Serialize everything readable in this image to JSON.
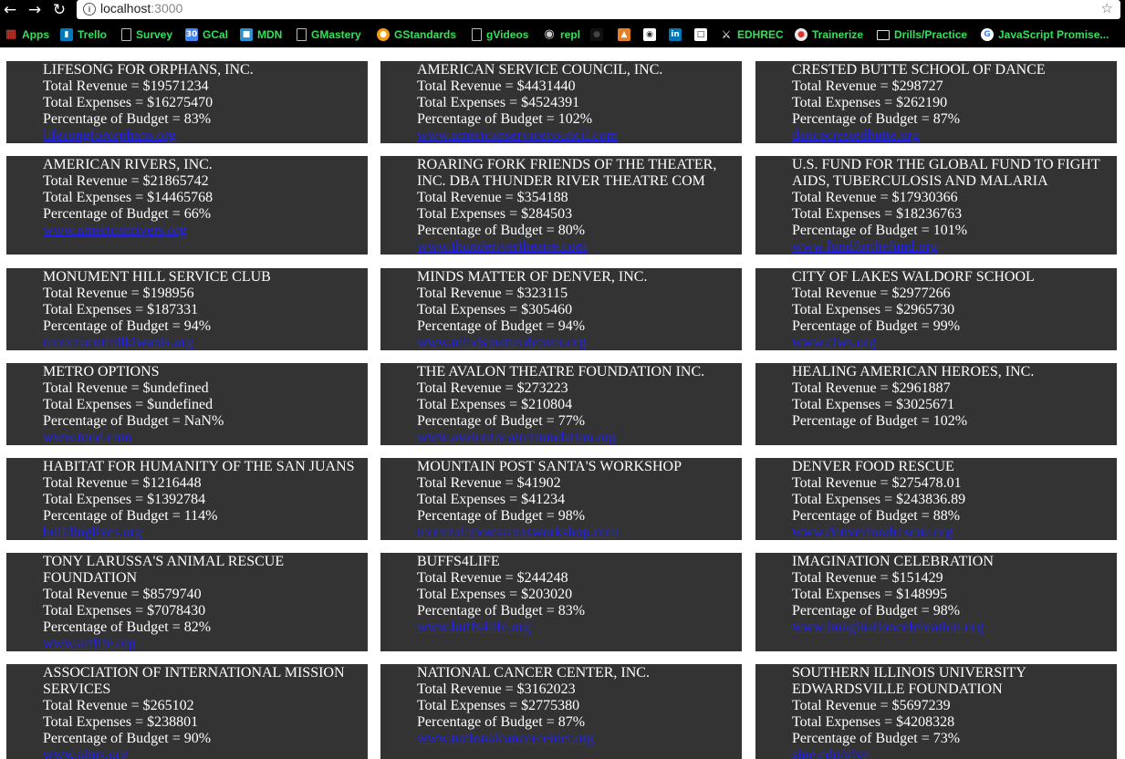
{
  "browser": {
    "url_host": "localhost",
    "url_port": ":3000",
    "bookmarks": [
      {
        "label": "Apps",
        "icon": "apps-grid-icon"
      },
      {
        "label": "Trello",
        "icon": "trello-icon"
      },
      {
        "label": "Survey",
        "icon": "page-icon"
      },
      {
        "label": "GCal",
        "icon": "calendar-icon",
        "badge": "30"
      },
      {
        "label": "MDN",
        "icon": "mdn-icon"
      },
      {
        "label": "GMastery",
        "icon": "page-icon"
      },
      {
        "label": "GStandards",
        "icon": "gstandards-icon"
      },
      {
        "label": "gVideos",
        "icon": "page-icon"
      },
      {
        "label": "repl",
        "icon": "repl-icon"
      },
      {
        "label": "",
        "icon": "github-icon"
      },
      {
        "label": "",
        "icon": "fitness-icon"
      },
      {
        "label": "",
        "icon": "owl-icon"
      },
      {
        "label": "",
        "icon": "linkedin-icon",
        "badge": "in"
      },
      {
        "label": "",
        "icon": "mtg-icon"
      },
      {
        "label": "EDHREC",
        "icon": "edhrec-icon"
      },
      {
        "label": "Trainerize",
        "icon": "trainerize-icon"
      },
      {
        "label": "Drills/Practice",
        "icon": "folder-icon"
      },
      {
        "label": "JavaScript Promise...",
        "icon": "google-icon"
      }
    ]
  },
  "labels": {
    "revenue": "Total Revenue = ",
    "expenses": "Total Expenses = ",
    "budget": "Percentage of Budget = "
  },
  "cards": [
    {
      "name": "LIFESONG FOR ORPHANS, INC.",
      "revenue": "$19571234",
      "expenses": "$16275470",
      "budget": "83%",
      "link": "lifesongfororphans.org"
    },
    {
      "name": "AMERICAN SERVICE COUNCIL, INC.",
      "revenue": "$4431440",
      "expenses": "$4524391",
      "budget": "102%",
      "link": "www.americanservicecouncil.com"
    },
    {
      "name": "CRESTED BUTTE SCHOOL OF DANCE",
      "revenue": "$298727",
      "expenses": "$262190",
      "budget": "87%",
      "link": "dancecrestedbutte.org"
    },
    {
      "name": "AMERICAN RIVERS, INC.",
      "revenue": "$21865742",
      "expenses": "$14465768",
      "budget": "66%",
      "link": "www.americanrivers.org"
    },
    {
      "name": "ROARING FORK FRIENDS OF THE THEATER, INC. DBA THUNDER RIVER THEATRE COM",
      "revenue": "$354188",
      "expenses": "$284503",
      "budget": "80%",
      "link": "www.thunderivertheatre.com"
    },
    {
      "name": "U.S. FUND FOR THE GLOBAL FUND TO FIGHT AIDS, TUBERCULOSIS AND MALARIA",
      "revenue": "$17930366",
      "expenses": "$18236763",
      "budget": "101%",
      "link": "www.fundforthefund.org"
    },
    {
      "name": "MONUMENT HILL SERVICE CLUB",
      "revenue": "$198956",
      "expenses": "$187331",
      "budget": "94%",
      "link": "monumenthillkiwanis.org"
    },
    {
      "name": "MINDS MATTER OF DENVER, INC.",
      "revenue": "$323115",
      "expenses": "$305460",
      "budget": "94%",
      "link": "www.mindsmatterdenver.org"
    },
    {
      "name": "CITY OF LAKES WALDORF SCHOOL",
      "revenue": "$2977266",
      "expenses": "$2965730",
      "budget": "99%",
      "link": "www.clws.org"
    },
    {
      "name": "METRO OPTIONS",
      "revenue": "$undefined",
      "expenses": "$undefined",
      "budget": "NaN%",
      "link": "www.mod.com"
    },
    {
      "name": "THE AVALON THEATRE FOUNDATION INC.",
      "revenue": "$273223",
      "expenses": "$210804",
      "budget": "77%",
      "link": "www.avalontheatrefoundation.org"
    },
    {
      "name": "HEALING AMERICAN HEROES, INC.",
      "revenue": "$2961887",
      "expenses": "$3025671",
      "budget": "102%",
      "link": ""
    },
    {
      "name": "HABITAT FOR HUMANITY OF THE SAN JUANS",
      "revenue": "$1216448",
      "expenses": "$1392784",
      "budget": "114%",
      "link": "buildinglives.org"
    },
    {
      "name": "MOUNTAIN POST SANTA'S WORKSHOP",
      "revenue": "$41902",
      "expenses": "$41234",
      "budget": "98%",
      "link": "mountainpostsantasworkshop.com"
    },
    {
      "name": "DENVER FOOD RESCUE",
      "revenue": "$275478.01",
      "expenses": "$243836.89",
      "budget": "88%",
      "link": "www.denverfoodrescue.org"
    },
    {
      "name": "TONY LARUSSA'S ANIMAL RESCUE FOUNDATION",
      "revenue": "$8579740",
      "expenses": "$7078430",
      "budget": "82%",
      "link": "www.arflife.org"
    },
    {
      "name": "BUFFS4LIFE",
      "revenue": "$244248",
      "expenses": "$203020",
      "budget": "83%",
      "link": "www.buffs4life.org"
    },
    {
      "name": "IMAGINATION CELEBRATION",
      "revenue": "$151429",
      "expenses": "$148995",
      "budget": "98%",
      "link": "www.imaginationcelebration.org"
    },
    {
      "name": "ASSOCIATION OF INTERNATIONAL MISSION SERVICES",
      "revenue": "$265102",
      "expenses": "$238801",
      "budget": "90%",
      "link": "www.aims.org"
    },
    {
      "name": "NATIONAL CANCER CENTER, INC.",
      "revenue": "$3162023",
      "expenses": "$2775380",
      "budget": "87%",
      "link": "www.nationalcancercenter.org"
    },
    {
      "name": "SOUTHERN ILLINOIS UNIVERSITY EDWARDSVILLE FOUNDATION",
      "revenue": "$5697239",
      "expenses": "$4208328",
      "budget": "73%",
      "link": "siue.edu/give"
    }
  ]
}
